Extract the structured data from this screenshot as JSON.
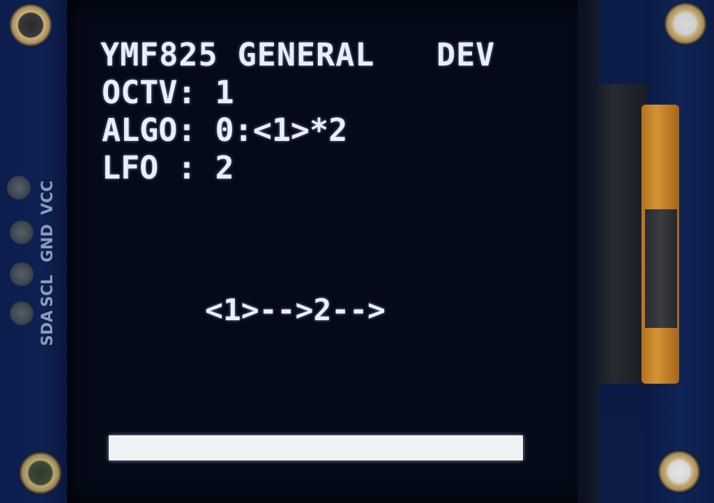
{
  "board": {
    "pins": [
      "SDA",
      "SCL",
      "GND",
      "VCC"
    ]
  },
  "oled": {
    "title": "YMF825 GENERAL",
    "mode": "DEV",
    "octave_line": "OCTV: 1",
    "algorithm_line": "ALGO: 0:<1>*2",
    "lfo_line": "LFO : 2",
    "algorithm_diagram": "<1>-->2-->",
    "level_bar_fraction": 1.0
  },
  "colors": {
    "oled_text": "#e8eefc",
    "pcb": "#0d1d4a",
    "flex_cable": "#d49435"
  }
}
